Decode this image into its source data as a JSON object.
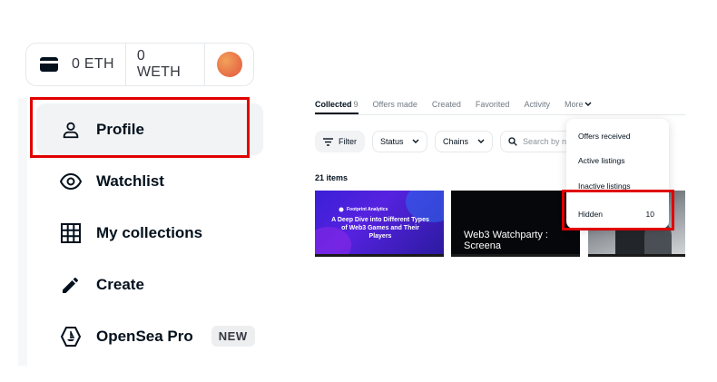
{
  "wallet": {
    "eth": "0 ETH",
    "weth": "0 WETH"
  },
  "menu": {
    "items": [
      {
        "label": "Profile",
        "icon": "person-icon",
        "active": true
      },
      {
        "label": "Watchlist",
        "icon": "eye-icon"
      },
      {
        "label": "My collections",
        "icon": "grid-icon"
      },
      {
        "label": "Create",
        "icon": "pencil-icon"
      },
      {
        "label": "OpenSea Pro",
        "icon": "opensea-pro-icon",
        "badge": "NEW"
      }
    ]
  },
  "profile": {
    "tabs": [
      {
        "label": "Collected",
        "count": "9",
        "active": true
      },
      {
        "label": "Offers made"
      },
      {
        "label": "Created"
      },
      {
        "label": "Favorited"
      },
      {
        "label": "Activity"
      },
      {
        "label": "More"
      }
    ],
    "filters": {
      "filter_label": "Filter",
      "status_label": "Status",
      "chains_label": "Chains",
      "search_placeholder": "Search by na"
    },
    "items_count": "21 items",
    "cards": [
      {
        "brand": "Footprint Analytics",
        "title": "A Deep Dive into Different Types of Web3 Games and Their Players"
      },
      {
        "title": "Web3 Watchparty : Screena"
      },
      {
        "title": ""
      }
    ]
  },
  "more_menu": {
    "items": [
      {
        "label": "Offers received"
      },
      {
        "label": "Active listings"
      },
      {
        "label": "Inactive listings"
      },
      {
        "label": "Hidden",
        "count": "10"
      }
    ]
  },
  "colors": {
    "highlight": "#e00000",
    "text_primary": "#04111d",
    "text_secondary": "#707a83"
  }
}
